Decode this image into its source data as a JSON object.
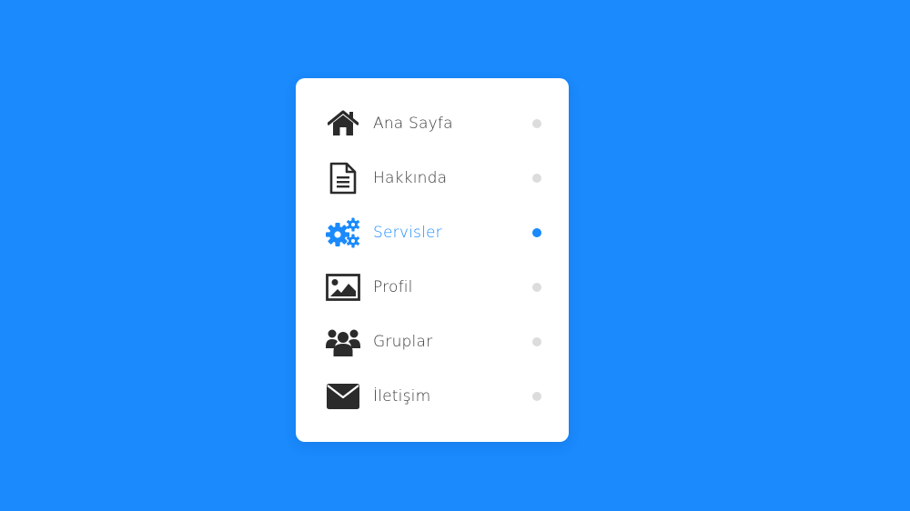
{
  "colors": {
    "background": "#1a8afd",
    "accent": "#1a8afd",
    "text": "#3a3a3a",
    "icon": "#2b2b2b",
    "dot_inactive": "#dcdcdc"
  },
  "menu": {
    "active_index": 2,
    "items": [
      {
        "label": "Ana Sayfa",
        "icon": "home-icon"
      },
      {
        "label": "Hakkında",
        "icon": "document-icon"
      },
      {
        "label": "Servisler",
        "icon": "gears-icon"
      },
      {
        "label": "Profil",
        "icon": "image-icon"
      },
      {
        "label": "Gruplar",
        "icon": "users-icon"
      },
      {
        "label": "İletişim",
        "icon": "envelope-icon"
      }
    ]
  }
}
